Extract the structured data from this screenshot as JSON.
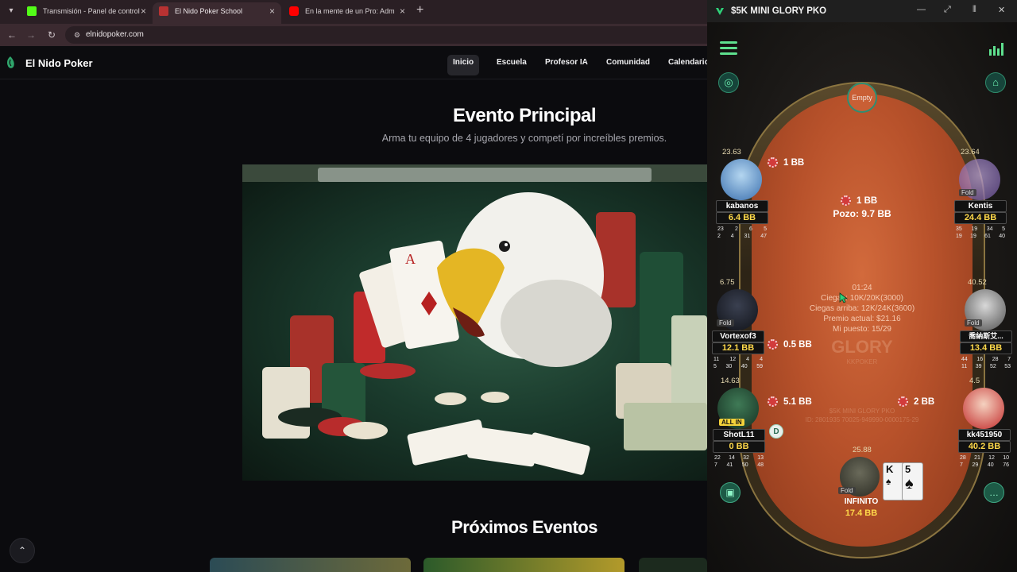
{
  "browser": {
    "tabs": [
      {
        "title": "Transmisión - Panel de control",
        "favicon_color": "#53fc18"
      },
      {
        "title": "El Nido Poker School",
        "favicon_color": "#b83232"
      },
      {
        "title": "En la mente de un Pro: Adm",
        "favicon_color": "#ff0000"
      }
    ],
    "new_tab_symbol": "+",
    "url": "elnidopoker.com"
  },
  "site": {
    "brand": "El Nido Poker",
    "nav": [
      "Inicio",
      "Escuela",
      "Profesor IA",
      "Comunidad",
      "Calendario"
    ],
    "active_nav": "Inicio",
    "hero_title": "Evento Principal",
    "hero_subtitle": "Arma tu equipo de 4 jugadores y competí por increíbles premios.",
    "upcoming_title": "Próximos Eventos"
  },
  "poker": {
    "window_title": "$5K MINI GLORY PKO",
    "empty_seat_label": "Empty",
    "pot_bet": "1 BB",
    "pot_total": "Pozo: 9.7 BB",
    "info": {
      "clock": "01:24",
      "blinds": "Ciegas: 10K/20K(3000)",
      "next_blinds": "Ciegas arriba: 12K/24K(3600)",
      "prize": "Premio actual: $21.16",
      "position": "Mi puesto: 15/29"
    },
    "brand_mark": "GLORY",
    "brand_sub": "KKPOKER",
    "watermark_line1": "$5K MINI GLORY PKO",
    "watermark_line2": "ID: 2801935 70025-949990-0000175-29",
    "dealer_label": "D",
    "hero_cards": [
      "K",
      "5"
    ],
    "players": [
      {
        "name": "kabanos",
        "stack": "6.4 BB",
        "timer": "23.63",
        "bet": "1 BB",
        "folded": false,
        "stats": [
          [
            "23",
            "2",
            "6",
            "5"
          ],
          [
            "2",
            "4",
            "31",
            "47"
          ]
        ]
      },
      {
        "name": "Kentis",
        "stack": "24.4 BB",
        "timer": "23.64",
        "bet": "",
        "folded": true,
        "stats": [
          [
            "35",
            "19",
            "34",
            "5"
          ],
          [
            "19",
            "19",
            "61",
            "40"
          ]
        ]
      },
      {
        "name": "Vortexof3",
        "stack": "12.1 BB",
        "timer": "6.75",
        "bet": "0.5 BB",
        "folded": true,
        "stats": [
          [
            "11",
            "12",
            "4",
            "4"
          ],
          [
            "5",
            "30",
            "40",
            "59"
          ]
        ]
      },
      {
        "name": "喬納斯艾...",
        "stack": "13.4 BB",
        "timer": "40.52",
        "bet": "",
        "folded": true,
        "stats": [
          [
            "44",
            "16",
            "28",
            "7"
          ],
          [
            "11",
            "39",
            "52",
            "53"
          ]
        ]
      },
      {
        "name": "ShotL11",
        "stack": "0 BB",
        "timer": "14.63",
        "bet": "5.1 BB",
        "folded": false,
        "allin": "ALL IN",
        "stats": [
          [
            "22",
            "14",
            "32",
            "13"
          ],
          [
            "7",
            "41",
            "50",
            "48"
          ]
        ]
      },
      {
        "name": "kk451950",
        "stack": "40.2 BB",
        "timer": "4.5",
        "bet": "2 BB",
        "folded": false,
        "stats": [
          [
            "28",
            "21",
            "12",
            "10"
          ],
          [
            "7",
            "29",
            "40",
            "76"
          ]
        ]
      },
      {
        "name": "INFINITO",
        "stack": "17.4 BB",
        "timer": "25.88",
        "bet": "",
        "folded": true,
        "stats": []
      }
    ],
    "fold_label": "Fold"
  }
}
